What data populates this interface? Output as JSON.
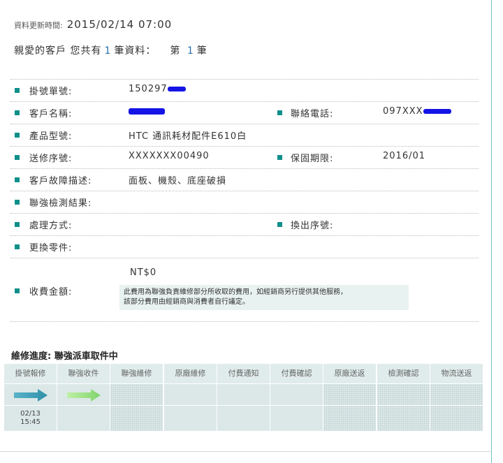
{
  "update": {
    "label": "資料更新時間:",
    "time": "2015/02/14 07:00"
  },
  "greeting": {
    "prefix": "親愛的客戶 您共有",
    "count": "1",
    "suffix": "筆資料：",
    "nth_prefix": "第",
    "nth": "1",
    "nth_suffix": "筆"
  },
  "fields": {
    "order_no": {
      "label": "掛號單號:",
      "value": "150297"
    },
    "customer": {
      "label": "客戶名稱:",
      "value": ""
    },
    "phone": {
      "label": "聯絡電話:",
      "value": "097XXX"
    },
    "model": {
      "label": "產品型號:",
      "value": "HTC 通訊耗材配件E610白"
    },
    "serial": {
      "label": "送修序號:",
      "value": "XXXXXXX00490"
    },
    "warranty": {
      "label": "保固期限:",
      "value": "2016/01"
    },
    "fault": {
      "label": "客戶故障描述:",
      "value": "面板、機殼、底座破損"
    },
    "test_result": {
      "label": "聯強檢測結果:",
      "value": ""
    },
    "handling": {
      "label": "處理方式:",
      "value": ""
    },
    "swap_serial": {
      "label": "換出序號:",
      "value": ""
    },
    "parts": {
      "label": "更換零件:",
      "value": ""
    },
    "fee": {
      "label": "收費金額:",
      "value": "NT$0",
      "note_line1": "此費用為聯強負責維修部分所收取的費用，如經銷商另行提供其他服務，",
      "note_line2": "該部分費用由經銷商與消費者自行議定。"
    }
  },
  "progress": {
    "title": "維修進度:  聯強派車取件中",
    "steps": [
      "掛號報修",
      "聯強收件",
      "聯強維修",
      "原廠維修",
      "付費通知",
      "付費確認",
      "原廠送返",
      "檢測確認",
      "物流送返"
    ],
    "completed": 2,
    "date1": "02/13",
    "date2": "15:45"
  },
  "colors": {
    "bullet": "#0e8f8a",
    "accent_num": "#2a6fa8",
    "redaction": "#1414e6"
  }
}
